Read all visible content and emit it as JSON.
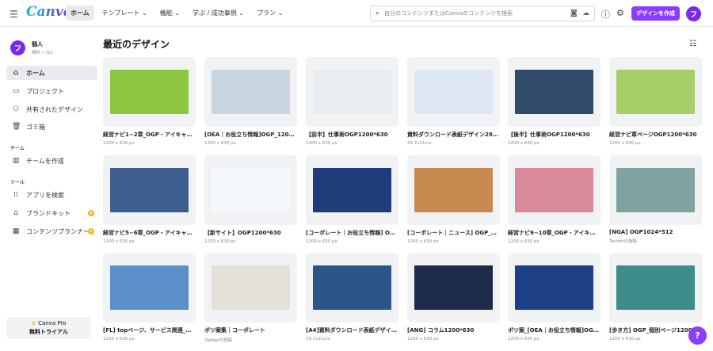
{
  "header": {
    "logo": "Canva",
    "menu_icon": "☰",
    "nav": [
      "ホーム",
      "テンプレート ⌄",
      "機能 ⌄",
      "学ぶ / 成功事例 ⌄",
      "プラン ⌄"
    ],
    "search_placeholder": "自分のコンテンツまたはCanvaのコンテンツを検索",
    "create_label": "デザインを作成",
    "avatar": "フ"
  },
  "account": {
    "name": "個人",
    "sub": "無料 • 占1",
    "avatar": "フ"
  },
  "sidebar": {
    "items": [
      {
        "label": "ホーム",
        "icon": "⌂"
      },
      {
        "label": "プロジェクト",
        "icon": "▭"
      },
      {
        "label": "共有されたデザイン",
        "icon": "⚇"
      },
      {
        "label": "ゴミ箱",
        "icon": "🗑"
      }
    ],
    "team_heading": "チーム",
    "team_items": [
      {
        "label": "チームを作成",
        "icon": "▥"
      }
    ],
    "tools_heading": "ツール",
    "tool_items": [
      {
        "label": "アプリを検索",
        "icon": "⁞⁞"
      },
      {
        "label": "ブランドキット",
        "icon": "⌂"
      },
      {
        "label": "コンテンツプランナー",
        "icon": "▦"
      }
    ],
    "pro_title": "Canva Pro",
    "pro_sub": "無料トライアル"
  },
  "main": {
    "title": "最近のデザイン",
    "designs": [
      {
        "title": "経営ナビ1~2章_OGP・アイキャッチ...",
        "size": "1200 x 630 px",
        "color": "#8cc63f"
      },
      {
        "title": "[OEA｜お役立ち情報]OGP_1200*630",
        "size": "1200 x 630 px",
        "color": "#c9d6e2"
      },
      {
        "title": "【前半】仕事術OGP1200*630",
        "size": "1200 x 630 px",
        "color": "#e8edf2"
      },
      {
        "title": "資料ダウンロード表紙デザイン29.7c...",
        "size": "29.7x21cm",
        "color": "#dfe8f2"
      },
      {
        "title": "【後半】仕事術OGP1200*630",
        "size": "1200 x 630 px",
        "color": "#2f4a6b"
      },
      {
        "title": "経営ナビ章ページOGP1200*630",
        "size": "1200 x 630 px",
        "color": "#a6cf6a"
      },
      {
        "title": "経営ナビ5~6章_OGP・アイキャッ...",
        "size": "1200 x 630 px",
        "color": "#3c5f8e"
      },
      {
        "title": "【新サイト】OGP1200*630",
        "size": "1200 x 630 px",
        "color": "#f4f7fb"
      },
      {
        "title": "[コーポレート｜お役立ち情報] OG...",
        "size": "1200 x 630 px",
        "color": "#1f3d7a"
      },
      {
        "title": "[コーポレート｜ニュース] OGP_個...",
        "size": "1200 x 630 px",
        "color": "#c98a52"
      },
      {
        "title": "経営ナビ9~10章_OGP・アイキャッ...",
        "size": "1200 x 630 px",
        "color": "#d98a9a"
      },
      {
        "title": "[NGA] OGP1024*512",
        "size": "Twitterの投稿",
        "color": "#7fa3a0"
      },
      {
        "title": "[FL] topページ、サービス関連_OG...",
        "size": "1200 x 630 px",
        "color": "#5b8fc7"
      },
      {
        "title": "ボツ案集｜コーポレート",
        "size": "Twitterの投稿",
        "color": "#e4e1db"
      },
      {
        "title": "[A4]資料ダウンロード表紙デザイン2...",
        "size": "29.7x21cm",
        "color": "#2b5788"
      },
      {
        "title": "[ANG] コラム1200*630",
        "size": "1200 x 630 px",
        "color": "#1c2b4a"
      },
      {
        "title": "ボツ案_[OEA｜お役立ち情報]OGP_1...",
        "size": "1200 x 630 px",
        "color": "#1d3f86"
      },
      {
        "title": "[歩き方] OGP_個別ページ1200*630",
        "size": "1200 x 630 px",
        "color": "#3e8d8a"
      }
    ]
  },
  "help_label": "?"
}
